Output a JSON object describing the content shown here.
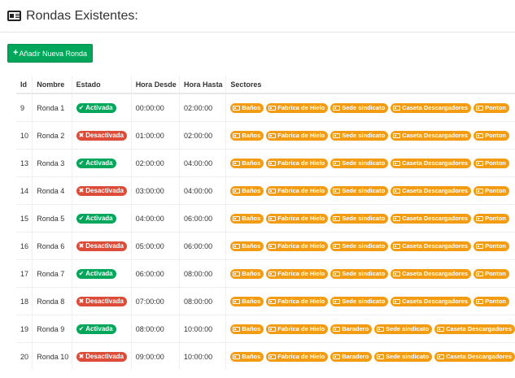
{
  "header": {
    "title": "Rondas Existentes:",
    "icon": "id-card-icon"
  },
  "add_button": {
    "label": "Añadir Nueva Ronda",
    "icon": "plus-icon"
  },
  "colors": {
    "active": "#00a65a",
    "inactive": "#dd4b39",
    "sector": "#f39c12"
  },
  "table": {
    "headers": [
      "Id",
      "Nombre",
      "Estado",
      "Hora Desde",
      "Hora Hasta",
      "Sectores"
    ],
    "rows": [
      {
        "id": "9",
        "nombre": "Ronda 1",
        "estado": "Activada",
        "active": true,
        "desde": "00:00:00",
        "hasta": "02:00:00",
        "sectores": [
          "Baños",
          "Fabrica de Hielo",
          "Sede sindicato",
          "Caseta Descargadores",
          "Ponton"
        ]
      },
      {
        "id": "10",
        "nombre": "Ronda 2",
        "estado": "Desactivada",
        "active": false,
        "desde": "01:00:00",
        "hasta": "02:00:00",
        "sectores": [
          "Baños",
          "Fabrica de Hielo",
          "Sede sindicato",
          "Caseta Descargadores",
          "Ponton"
        ]
      },
      {
        "id": "13",
        "nombre": "Ronda 3",
        "estado": "Activada",
        "active": true,
        "desde": "02:00:00",
        "hasta": "04:00:00",
        "sectores": [
          "Baños",
          "Fabrica de Hielo",
          "Sede sindicato",
          "Caseta Descargadores",
          "Ponton"
        ]
      },
      {
        "id": "14",
        "nombre": "Ronda 4",
        "estado": "Desactivada",
        "active": false,
        "desde": "03:00:00",
        "hasta": "04:00:00",
        "sectores": [
          "Baños",
          "Fabrica de Hielo",
          "Sede sindicato",
          "Caseta Descargadores",
          "Ponton"
        ]
      },
      {
        "id": "15",
        "nombre": "Ronda 5",
        "estado": "Activada",
        "active": true,
        "desde": "04:00:00",
        "hasta": "06:00:00",
        "sectores": [
          "Baños",
          "Fabrica de Hielo",
          "Sede sindicato",
          "Caseta Descargadores",
          "Ponton"
        ]
      },
      {
        "id": "16",
        "nombre": "Ronda 6",
        "estado": "Desactivada",
        "active": false,
        "desde": "05:00:00",
        "hasta": "06:00:00",
        "sectores": [
          "Baños",
          "Fabrica de Hielo",
          "Sede sindicato",
          "Caseta Descargadores",
          "Ponton"
        ]
      },
      {
        "id": "17",
        "nombre": "Ronda 7",
        "estado": "Activada",
        "active": true,
        "desde": "06:00:00",
        "hasta": "08:00:00",
        "sectores": [
          "Baños",
          "Fabrica de Hielo",
          "Sede sindicato",
          "Caseta Descargadores",
          "Ponton"
        ]
      },
      {
        "id": "18",
        "nombre": "Ronda 8",
        "estado": "Desactivada",
        "active": false,
        "desde": "07:00:00",
        "hasta": "08:00:00",
        "sectores": [
          "Baños",
          "Fabrica de Hielo",
          "Sede sindicato",
          "Caseta Descargadores",
          "Ponton"
        ]
      },
      {
        "id": "19",
        "nombre": "Ronda 9",
        "estado": "Activada",
        "active": true,
        "desde": "08:00:00",
        "hasta": "10:00:00",
        "sectores": [
          "Baños",
          "Fabrica de Hielo",
          "Baradero",
          "Sede sindicato",
          "Caseta Descargadores"
        ]
      },
      {
        "id": "20",
        "nombre": "Ronda 10",
        "estado": "Desactivada",
        "active": false,
        "desde": "09:00:00",
        "hasta": "10:00:00",
        "sectores": [
          "Baños",
          "Fabrica de Hielo",
          "Baradero",
          "Sede sindicato",
          "Caseta Descargadores"
        ]
      }
    ]
  }
}
